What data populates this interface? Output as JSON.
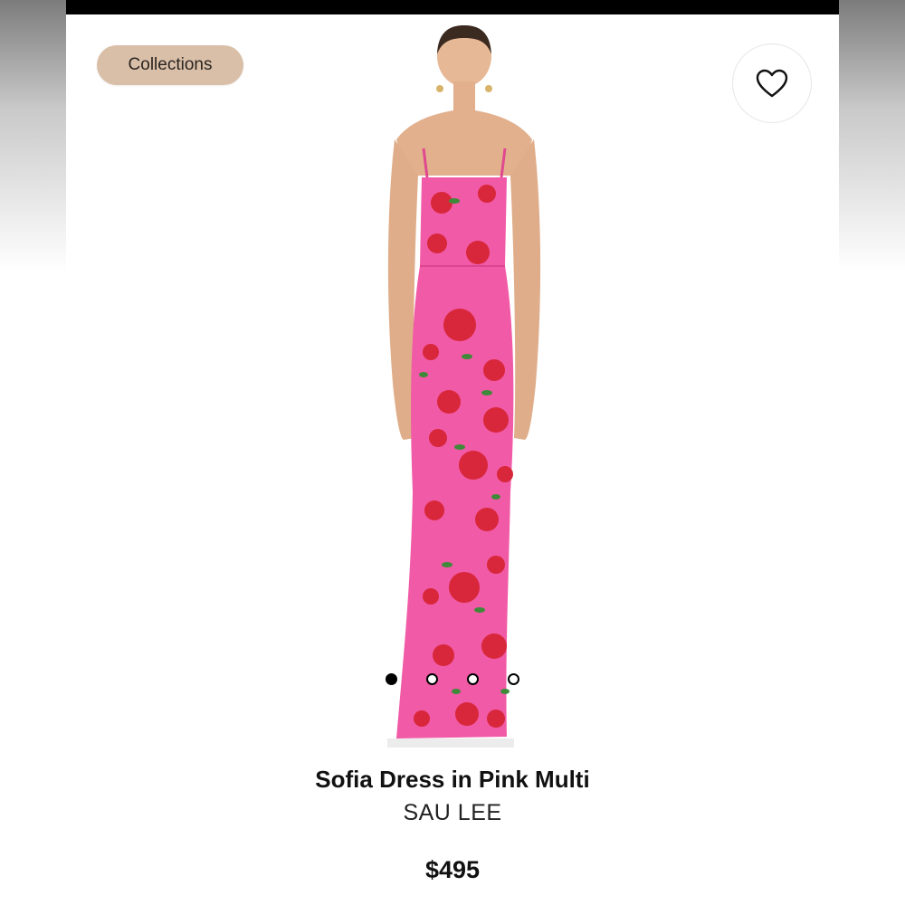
{
  "header": {
    "collections_label": "Collections"
  },
  "product": {
    "image_alt": "Model wearing pink rose-print maxi dress",
    "name": "Sofia Dress in Pink Multi",
    "brand": "SAU LEE",
    "price": "$495"
  },
  "gallery": {
    "count": 4,
    "active_index": 0
  },
  "icons": {
    "favorite": "heart-outline-icon"
  },
  "colors": {
    "chip_bg": "#d9bfa8",
    "dress_pink": "#f15aa6",
    "rose_red": "#d8273a",
    "leaf_green": "#3f8a3a"
  }
}
